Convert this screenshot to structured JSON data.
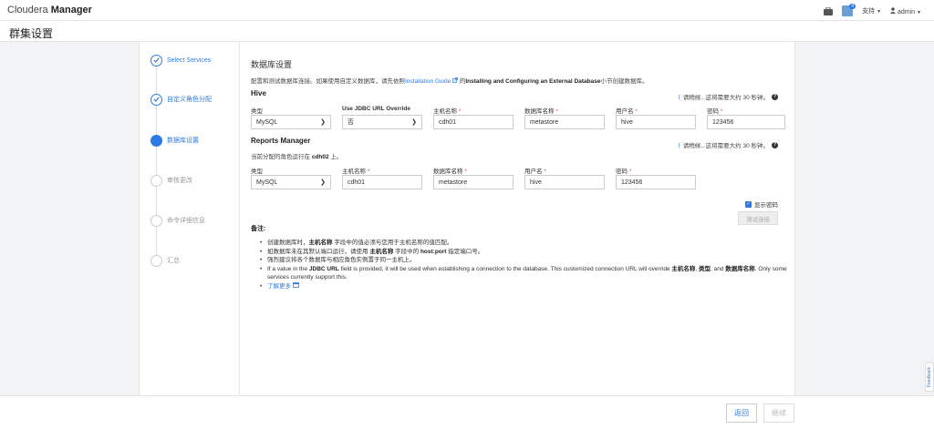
{
  "topbar": {
    "brand_light": "Cloudera",
    "brand_bold": "Manager",
    "support_label": "支持",
    "user_label": "admin",
    "badge_count": "4",
    "icons": [
      "briefcase-icon",
      "notification-icon",
      "user-icon"
    ]
  },
  "page": {
    "title": "群集设置"
  },
  "steps": [
    {
      "label": "Select Services",
      "state": "done"
    },
    {
      "label": "自定义角色分配",
      "state": "done"
    },
    {
      "label": "数据库设置",
      "state": "active"
    },
    {
      "label": "审核更改",
      "state": "pending"
    },
    {
      "label": "命令详细信息",
      "state": "pending"
    },
    {
      "label": "汇总",
      "state": "pending"
    }
  ],
  "main": {
    "heading": "数据库设置",
    "intro_pre": "配置和测试数据库连接。如果使用自定义数据库，请先依照",
    "intro_link": "Installation Guide",
    "intro_mid": "的",
    "intro_bold": "Installing and Configuring an External Database",
    "intro_post": "小节创建数据库。",
    "wait_text": "请稍候...这将需要大约 30 秒钟。",
    "required_mark": "*",
    "hive": {
      "title": "Hive",
      "labels": {
        "type": "类型",
        "jdbc": "Use JDBC URL Override",
        "host": "主机名称",
        "dbname": "数据库名称",
        "user": "用户名",
        "password": "密码"
      },
      "values": {
        "type": "MySQL",
        "jdbc": "否",
        "host": "cdh01",
        "dbname": "metastore",
        "user": "hive",
        "password": "123456"
      }
    },
    "reports": {
      "title": "Reports Manager",
      "note_pre": "当前分配的角色运行在",
      "note_host": "cdh02",
      "note_post": "上。",
      "labels": {
        "type": "类型",
        "host": "主机名称",
        "dbname": "数据库名称",
        "user": "用户名",
        "password": "密码"
      },
      "values": {
        "type": "MySQL",
        "host": "cdh01",
        "dbname": "metastore",
        "user": "hive",
        "password": "123456"
      }
    },
    "show_password_label": "显示密码",
    "test_button": "测试连接",
    "notes_title": "备注:",
    "notes": {
      "n1_pre": "创建数据库时，",
      "n1_bold": "主机名称",
      "n1_post": "字段中的值必须与您用于主机名称的值匹配。",
      "n2_pre": "如数据库未在其默认端口运行，请使用",
      "n2_bold1": "主机名称",
      "n2_mid": "字段中的",
      "n2_bold2": "host:port",
      "n2_post": "指定端口号。",
      "n3": "强烈建议将各个数据库与相应角色实例置于同一主机上。",
      "n4_pre": "If a value in the",
      "n4_b1": "JDBC URL",
      "n4_mid1": "field is provided, it will be used when establishing a connection to the database. This customized connection URL will override",
      "n4_b2": "主机名称",
      "n4_b3": "类型",
      "n4_and": "and",
      "n4_b4": "数据库名称",
      "n4_post": "Only some services currently support this.",
      "learn_more": "了解更多"
    }
  },
  "footer": {
    "back_label": "返回",
    "next_label": "继续"
  },
  "feedback_label": "Feedback",
  "colors": {
    "accent": "#2c7be5",
    "required": "#d9534f"
  }
}
